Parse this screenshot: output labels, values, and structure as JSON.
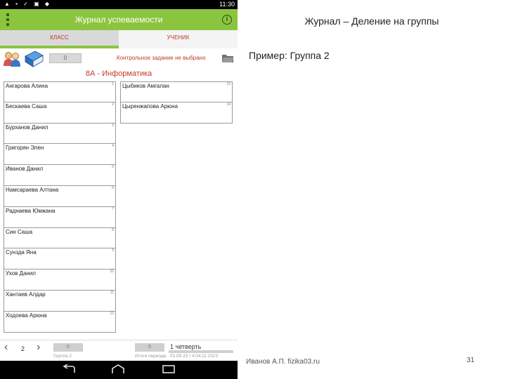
{
  "status_bar": {
    "icons_left": "▲ ▪ ✓ ▣ ◆",
    "time": "11:30"
  },
  "app_bar": {
    "title": "Журнал успеваемости",
    "info_icon": "i"
  },
  "tabs": [
    {
      "label": "КЛАСС",
      "active": true
    },
    {
      "label": "УЧЕНИК",
      "active": false
    }
  ],
  "toolbar": {
    "score_value": "0",
    "task_text": "Контрольное задание не выбрано"
  },
  "class_title": "8А - Информатика",
  "group_left": [
    {
      "name": "Ангарова Алина",
      "num": "1"
    },
    {
      "name": "Бескаева Саша",
      "num": "2"
    },
    {
      "name": "Бурханов Данил",
      "num": "3"
    },
    {
      "name": "Григорян Элен",
      "num": "4"
    },
    {
      "name": "Иванов Данил",
      "num": "5"
    },
    {
      "name": "Намсараева Алтана",
      "num": "6"
    },
    {
      "name": "Раднаева Юмжана",
      "num": "7"
    },
    {
      "name": "Син Саша",
      "num": "8"
    },
    {
      "name": "Сунзда Яна",
      "num": "9"
    },
    {
      "name": "Ухов Данил",
      "num": "10"
    },
    {
      "name": "Хантаев Алдар",
      "num": "11"
    },
    {
      "name": "Ходоева Арюна",
      "num": "12"
    }
  ],
  "group_right": [
    {
      "name": "Цыбиков Амгалан",
      "num": "13"
    },
    {
      "name": "Цыренжапова Арюна",
      "num": "14"
    }
  ],
  "bottom_bar": {
    "page_prev": "‹",
    "page_num": "2",
    "page_next": "›",
    "score1": "0",
    "label1": "Группа 2",
    "score2": "0",
    "label2": "Итоги периода",
    "quarter": "1 четверть",
    "period": "01.09.23 / 4.04.11.2023"
  },
  "slide": {
    "title": "Журнал – Деление на группы",
    "subtitle": "Пример: Группа 2",
    "author": "Иванов А.П. fizika03.ru",
    "page_number": "31"
  },
  "colors": {
    "accent": "#8bc53f",
    "text_red": "#c0392b"
  }
}
